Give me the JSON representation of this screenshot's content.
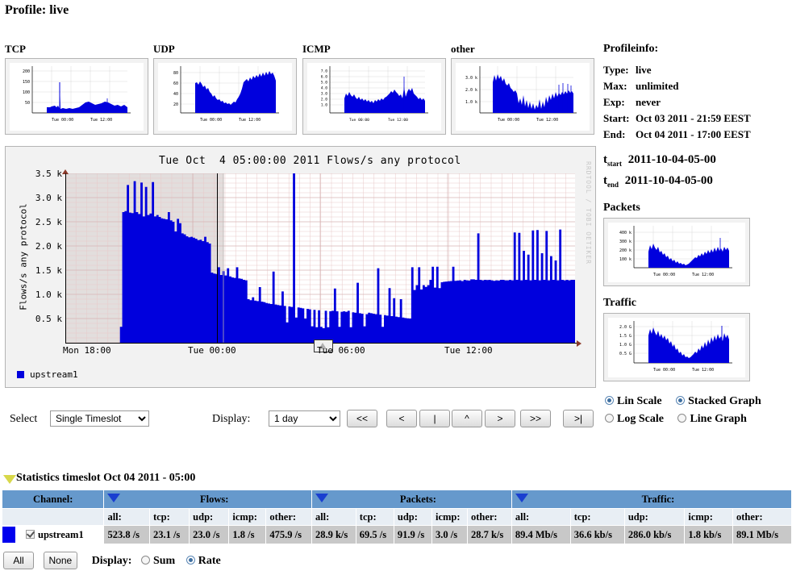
{
  "page": {
    "title": "Profile: live"
  },
  "thumbnails": [
    {
      "label": "TCP",
      "yticks": [
        "200",
        "150",
        "100",
        "50"
      ],
      "xticks": [
        "Tue 00:00",
        "Tue 12:00"
      ]
    },
    {
      "label": "UDP",
      "yticks": [
        "80",
        "60",
        "40",
        "20"
      ],
      "xticks": [
        "Tue 00:00",
        "Tue 12:00"
      ]
    },
    {
      "label": "ICMP",
      "yticks": [
        "7.0",
        "6.0",
        "5.0",
        "4.0",
        "3.0",
        "2.0",
        "1.0"
      ],
      "xticks": [
        "Tue 00:00",
        "Tue 12:00"
      ]
    },
    {
      "label": "other",
      "yticks": [
        "3.0 k",
        "2.0 k",
        "1.0 k"
      ],
      "xticks": [
        "Tue 00:00",
        "Tue 12:00"
      ]
    }
  ],
  "main_graph": {
    "title": "Tue Oct  4 05:00:00 2011 Flows/s any protocol",
    "ylabel": "Flows/s any protocol",
    "credit": "RRDTOOL / TOBI OETIKER",
    "legend_label": "upstream1",
    "legend_color": "#0000dd"
  },
  "profileinfo": {
    "heading": "Profileinfo:",
    "rows": [
      {
        "key": "Type:",
        "value": "live"
      },
      {
        "key": "Max:",
        "value": "unlimited"
      },
      {
        "key": "Exp:",
        "value": "never"
      },
      {
        "key": "Start:",
        "value": "Oct 03 2011 - 21:59 EEST"
      },
      {
        "key": "End:",
        "value": "Oct 04 2011 - 17:00 EEST"
      }
    ],
    "t_start_label": "t",
    "t_start_sub": "start",
    "t_start_value": "2011-10-04-05-00",
    "t_end_label": "t",
    "t_end_sub": "end",
    "t_end_value": "2011-10-04-05-00",
    "packets_heading": "Packets",
    "traffic_heading": "Traffic",
    "packets_yticks": [
      "400 k",
      "300 k",
      "200 k",
      "100 k"
    ],
    "traffic_yticks": [
      "2.0 G",
      "1.5 G",
      "1.0 G",
      "0.5 G"
    ],
    "side_xticks": [
      "Tue 00:00",
      "Tue 12:00"
    ]
  },
  "controls": {
    "select_label": "Select",
    "select_value": "Single Timeslot",
    "select_options": [
      "Single Timeslot"
    ],
    "display_label": "Display:",
    "display_value": "1 day",
    "display_options": [
      "1 day"
    ],
    "nav_buttons": [
      "<<",
      "<",
      "|",
      "^",
      ">",
      ">>",
      ">|"
    ],
    "scale_options": [
      {
        "label": "Lin Scale",
        "selected": true
      },
      {
        "label": "Log Scale",
        "selected": false
      }
    ],
    "graph_options": [
      {
        "label": "Stacked Graph",
        "selected": true
      },
      {
        "label": "Line Graph",
        "selected": false
      }
    ]
  },
  "statistics": {
    "title": "Statistics timeslot Oct 04 2011 - 05:00",
    "groups": [
      "Channel:",
      "Flows:",
      "Packets:",
      "Traffic:"
    ],
    "subheaders": [
      "all:",
      "tcp:",
      "udp:",
      "icmp:",
      "other:"
    ],
    "rows": [
      {
        "channel": "upstream1",
        "checked": true,
        "color": "#0000ee",
        "flows": [
          "523.8 /s",
          "23.1 /s",
          "23.0 /s",
          "1.8 /s",
          "475.9 /s"
        ],
        "packets": [
          "28.9 k/s",
          "69.5 /s",
          "91.9 /s",
          "3.0 /s",
          "28.7 k/s"
        ],
        "traffic": [
          "89.4 Mb/s",
          "36.6 kb/s",
          "286.0 kb/s",
          "1.8 kb/s",
          "89.1 Mb/s"
        ]
      }
    ],
    "all_button": "All",
    "none_button": "None",
    "display_label": "Display:",
    "display_modes": [
      {
        "label": "Sum",
        "selected": false
      },
      {
        "label": "Rate",
        "selected": true
      }
    ]
  },
  "chart_data": {
    "type": "area",
    "title": "Tue Oct  4 05:00:00 2011 Flows/s any protocol",
    "ylabel": "Flows/s any protocol",
    "xlabel": "",
    "ylim": [
      0,
      3500
    ],
    "yticks": [
      500,
      1000,
      1500,
      2000,
      2500,
      3000,
      3500
    ],
    "ytick_labels": [
      "0.5 k",
      "1.0 k",
      "1.5 k",
      "2.0 k",
      "2.5 k",
      "3.0 k",
      "3.5 k"
    ],
    "xticks": [
      "Mon 18:00",
      "Tue 00:00",
      "Tue 06:00",
      "Tue 12:00"
    ],
    "grid": true,
    "legend": [
      "upstream1"
    ],
    "legend_position": "bottom-left",
    "series": [
      {
        "name": "upstream1",
        "color": "#0000dd",
        "values": [
          0,
          0,
          0,
          0,
          0,
          0,
          0,
          0,
          0,
          0,
          0,
          0,
          0,
          0,
          0,
          0,
          0,
          0,
          0,
          0,
          0,
          0,
          0,
          0,
          330,
          2700,
          2720,
          3260,
          2690,
          2680,
          3340,
          2700,
          2660,
          3310,
          2610,
          3220,
          2640,
          2670,
          3320,
          2610,
          2640,
          2600,
          2570,
          2560,
          2550,
          2700,
          2530,
          2500,
          2300,
          2560,
          2470,
          2260,
          2240,
          2200,
          2180,
          2190,
          2170,
          2150,
          2120,
          2130,
          2100,
          2190,
          2080,
          2050,
          1450,
          1430,
          1420,
          1560,
          1400,
          1480,
          1390,
          1540,
          1370,
          1350,
          1340,
          1560,
          1330,
          1320,
          1300,
          1290,
          900,
          880,
          940,
          870,
          860,
          1150,
          850,
          840,
          820,
          810,
          800,
          1470,
          790,
          780,
          770,
          1060,
          760,
          420,
          750,
          740,
          3500,
          520,
          730,
          720,
          710,
          500,
          700,
          690,
          340,
          680,
          320,
          670,
          330,
          300,
          660,
          320,
          650,
          660,
          1120,
          650,
          330,
          640,
          650,
          640,
          660,
          320,
          630,
          620,
          1240,
          610,
          600,
          340,
          590,
          620,
          610,
          600,
          590,
          1540,
          580,
          330,
          570,
          560,
          1130,
          550,
          920,
          540,
          530,
          900,
          520,
          510,
          505,
          500,
          1560,
          1090,
          1190,
          1560,
          1100,
          1190,
          1155,
          1190,
          1300,
          1570,
          1140,
          1570,
          1130,
          1250,
          1260,
          1265,
          1270,
          1275,
          1570,
          1280,
          1285,
          1290,
          1275,
          1300,
          1290,
          1285,
          1310,
          1310,
          1300,
          2260,
          1300,
          1290,
          1300,
          1295,
          1300,
          1290,
          1280,
          1290,
          1285,
          1300,
          1300,
          1290,
          1290,
          1300,
          1290,
          2280,
          1300,
          2270,
          1290,
          1900,
          1300,
          1820,
          1290,
          2320,
          1300,
          2330,
          1290,
          1850,
          1300,
          2310,
          1290,
          1790,
          1300,
          1700,
          1290,
          2340,
          1300,
          1290,
          1300,
          1290,
          1300,
          1300
        ]
      }
    ]
  }
}
